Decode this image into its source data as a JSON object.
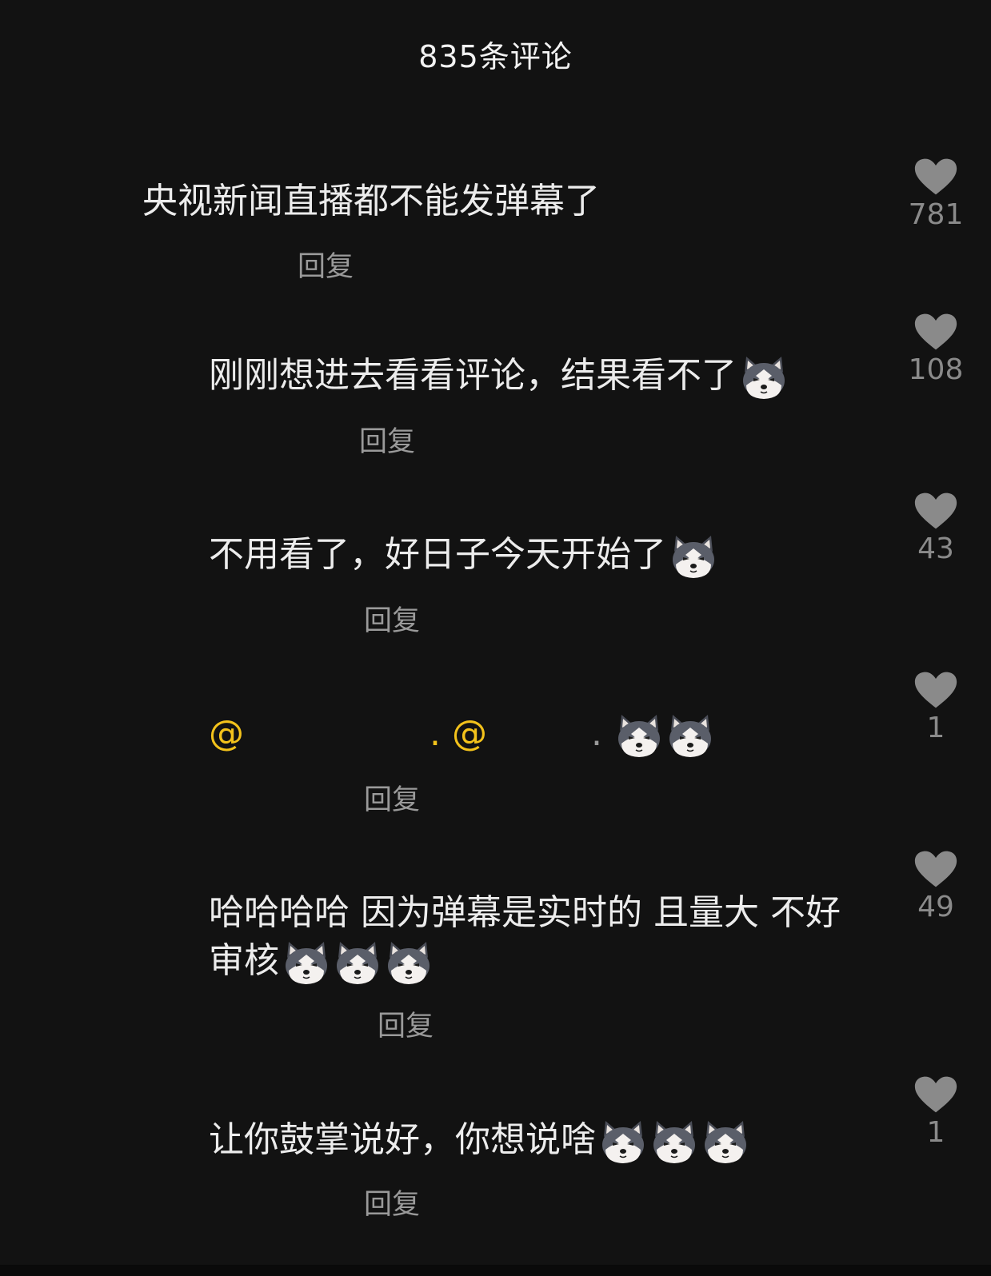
{
  "header": {
    "title": "835条评论"
  },
  "comments": [
    {
      "text": "央视新闻直播都不能发弹幕了",
      "reply": "回复",
      "likes": "781"
    },
    {
      "text": "刚刚想进去看看评论，结果看不了",
      "reply": "回复",
      "likes": "108"
    },
    {
      "text": "不用看了，好日子今天开始了",
      "reply": "回复",
      "likes": "43"
    },
    {
      "mention1": "@",
      "sep": ". ",
      "mention2": "@",
      "tail": ".",
      "reply": "回复",
      "likes": "1"
    },
    {
      "text": "哈哈哈哈 因为弹幕是实时的 且量大 不好审核",
      "reply": "回复",
      "likes": "49"
    },
    {
      "text": "让你鼓掌说好，你想说啥",
      "reply": "回复",
      "likes": "1"
    }
  ],
  "colors": {
    "background": "#121212",
    "mention": "#f3c21b",
    "secondary_text": "#9a9a9a"
  },
  "icons": {
    "like": "heart-icon",
    "emoji": "husky-dog-emoji-icon"
  }
}
